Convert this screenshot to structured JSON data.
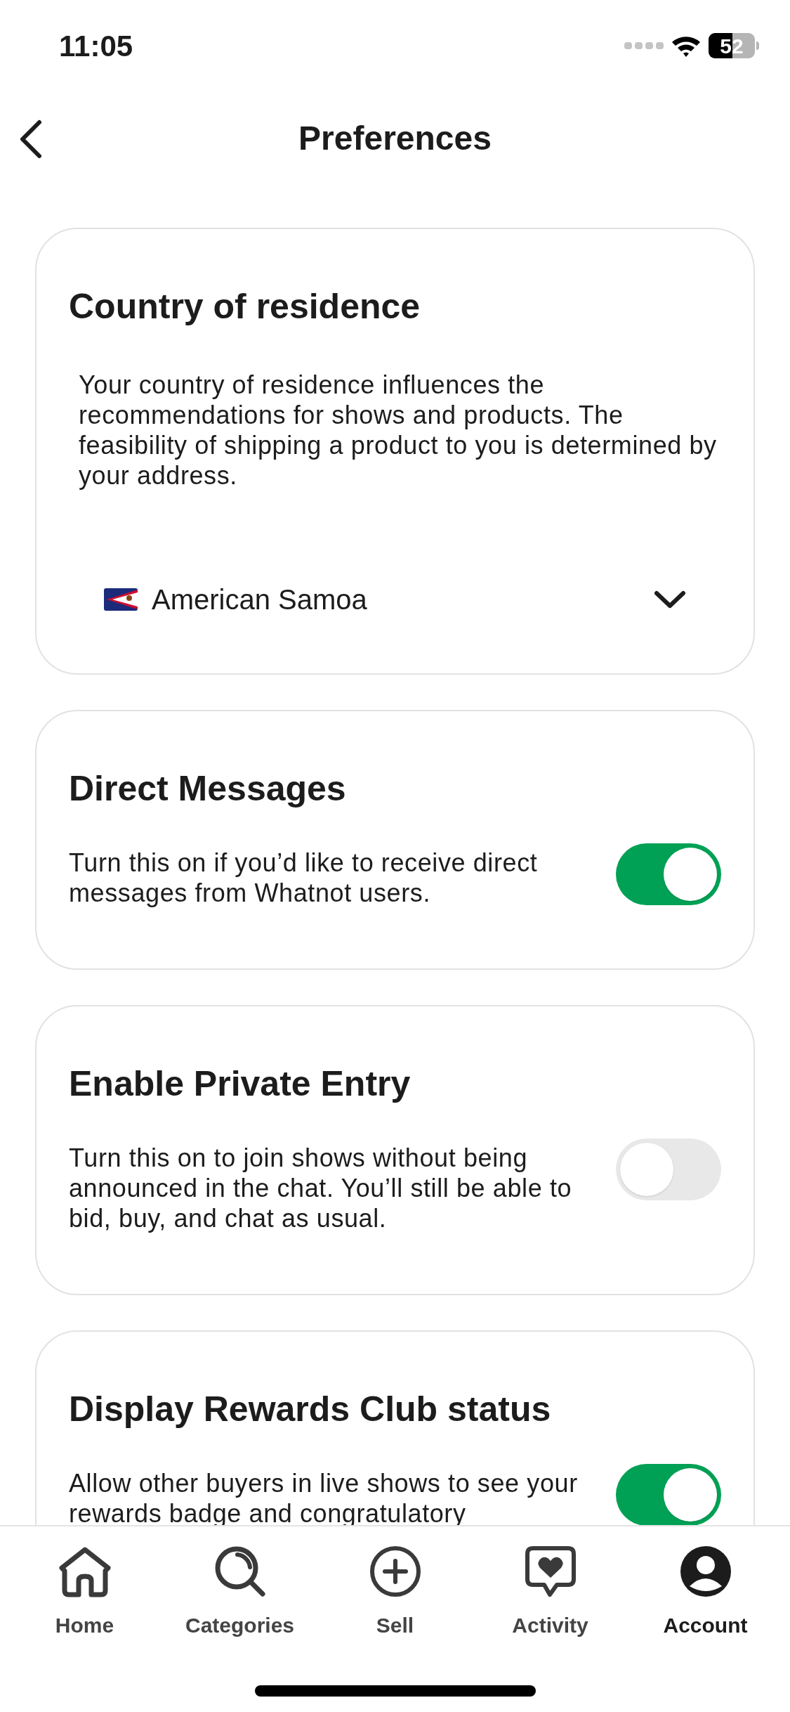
{
  "status_bar": {
    "time": "11:05",
    "battery": "52"
  },
  "header": {
    "title": "Preferences"
  },
  "cards": [
    {
      "kind": "dropdown",
      "title": "Country of residence",
      "description": "Your country of residence influences the recommendations for shows and products. The feasibility of shipping a product to you is determined by your address.",
      "value": "American Samoa"
    },
    {
      "kind": "toggle",
      "title": "Direct Messages",
      "description": "Turn this on if you’d like to receive direct messages from Whatnot users.",
      "on": true
    },
    {
      "kind": "toggle",
      "title": "Enable Private Entry",
      "description": "Turn this on to join shows without being announced in the chat. You’ll still be able to bid, buy, and chat as usual.",
      "on": false
    },
    {
      "kind": "toggle",
      "title": "Display Rewards Club status",
      "description": "Allow other buyers in live shows to see your rewards badge and congratulatory",
      "on": true
    }
  ],
  "tab_bar": [
    {
      "kind": "home",
      "label": "Home",
      "selected": false
    },
    {
      "kind": "categories",
      "label": "Categories",
      "selected": false
    },
    {
      "kind": "sell",
      "label": "Sell",
      "selected": false
    },
    {
      "kind": "activity",
      "label": "Activity",
      "selected": false
    },
    {
      "kind": "account",
      "label": "Account",
      "selected": true
    }
  ]
}
